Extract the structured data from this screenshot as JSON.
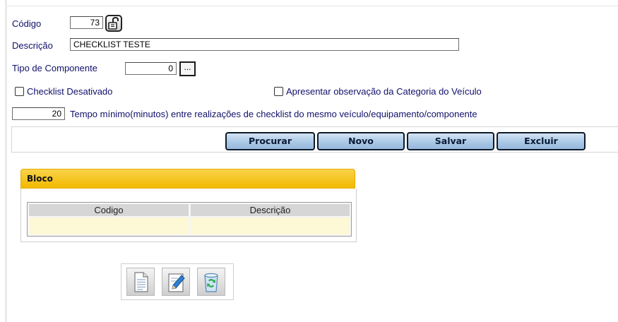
{
  "form": {
    "codigo_label": "Código",
    "codigo_value": "73",
    "descricao_label": "Descrição",
    "descricao_value": "CHECKLIST TESTE",
    "tipo_label": "Tipo de Componente",
    "tipo_value": "0",
    "tipo_lookup_label": "...",
    "chk_desativado_label": "Checklist Desativado",
    "chk_desativado_checked": false,
    "chk_observacao_label": "Apresentar observação da Categoria do Veículo",
    "chk_observacao_checked": false,
    "tempo_value": "20",
    "tempo_label": "Tempo mínimo(minutos) entre realizações de checklist do mesmo veículo/equipamento/componente"
  },
  "buttons": {
    "procurar": "Procurar",
    "novo": "Novo",
    "salvar": "Salvar",
    "excluir": "Excluir"
  },
  "bloco": {
    "title": "Bloco",
    "columns": [
      "Codigo",
      "Descrição"
    ],
    "rows": []
  },
  "toolbar": {
    "icons": [
      "new-document-icon",
      "edit-icon",
      "recycle-bin-icon"
    ]
  },
  "colors": {
    "label_text": "#10106a",
    "button_fill": "#aac8e6",
    "tab_yellow": "#f2b900",
    "grid_row": "#fdf8d6"
  }
}
